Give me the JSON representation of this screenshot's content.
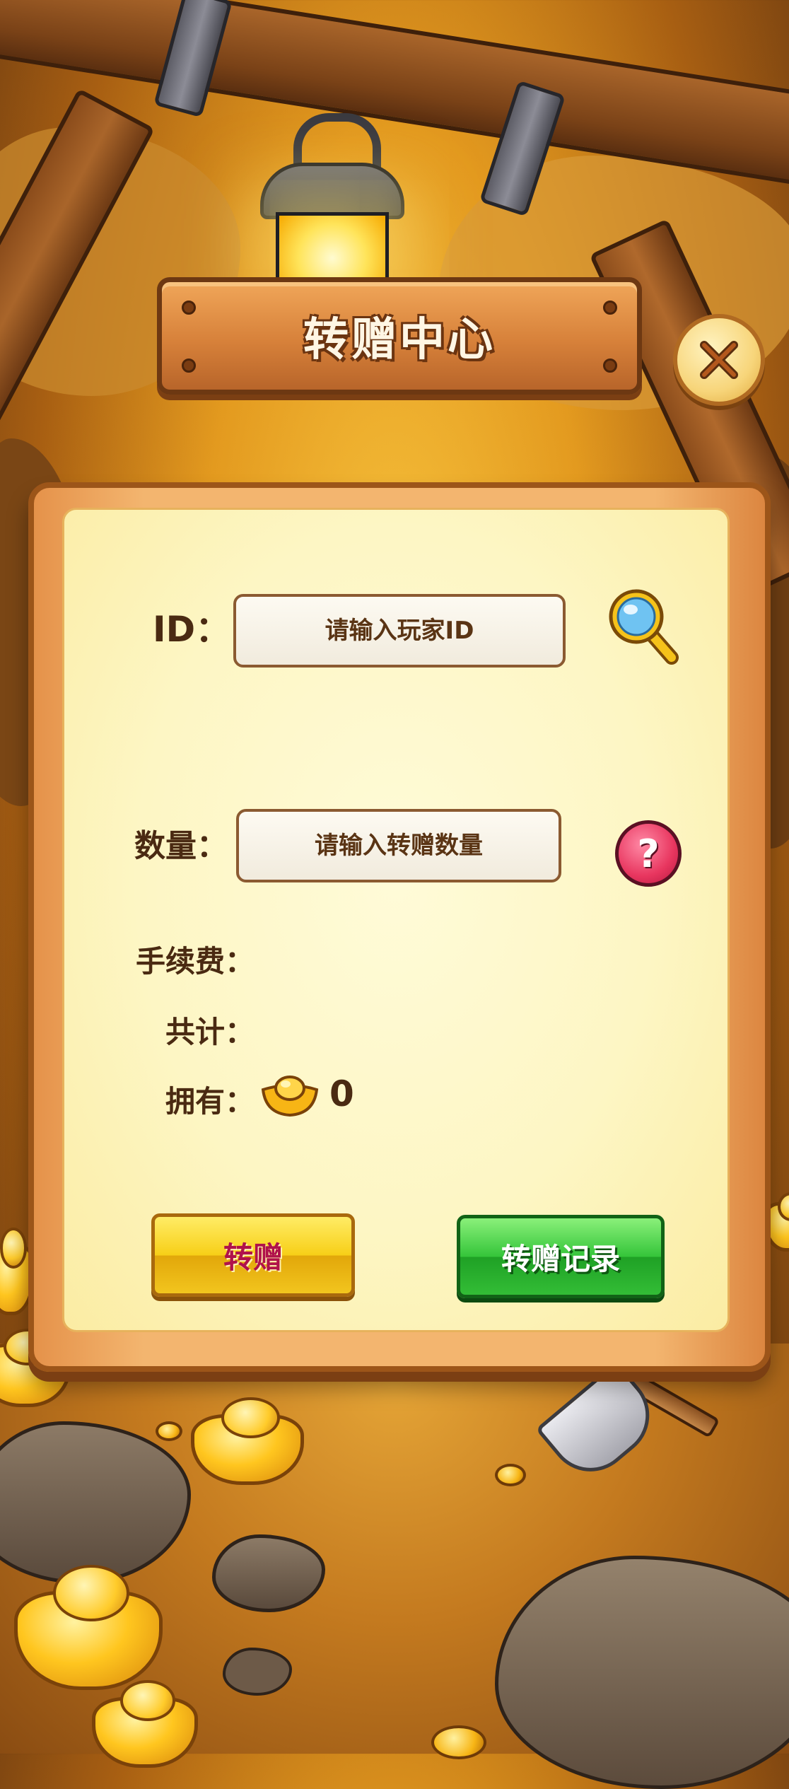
{
  "header": {
    "title": "转赠中心",
    "close_icon": "close-icon"
  },
  "form": {
    "id_label": "ID：",
    "id_placeholder": "请输入玩家ID",
    "search_icon": "magnifier-icon",
    "amount_label": "数量：",
    "amount_placeholder": "请输入转赠数量",
    "help_icon": "question-mark-icon",
    "help_symbol": "?",
    "fee_label": "手续费：",
    "total_label": "共计：",
    "owned_label": "拥有：",
    "owned_currency_icon": "gold-ingot-icon",
    "owned_value": "0"
  },
  "actions": {
    "transfer_label": "转赠",
    "records_label": "转赠记录"
  },
  "colors": {
    "transfer_button": "#f7cf17",
    "records_button": "#35c53a",
    "panel": "#fdf6c4",
    "label_text": "#4a2a12"
  }
}
